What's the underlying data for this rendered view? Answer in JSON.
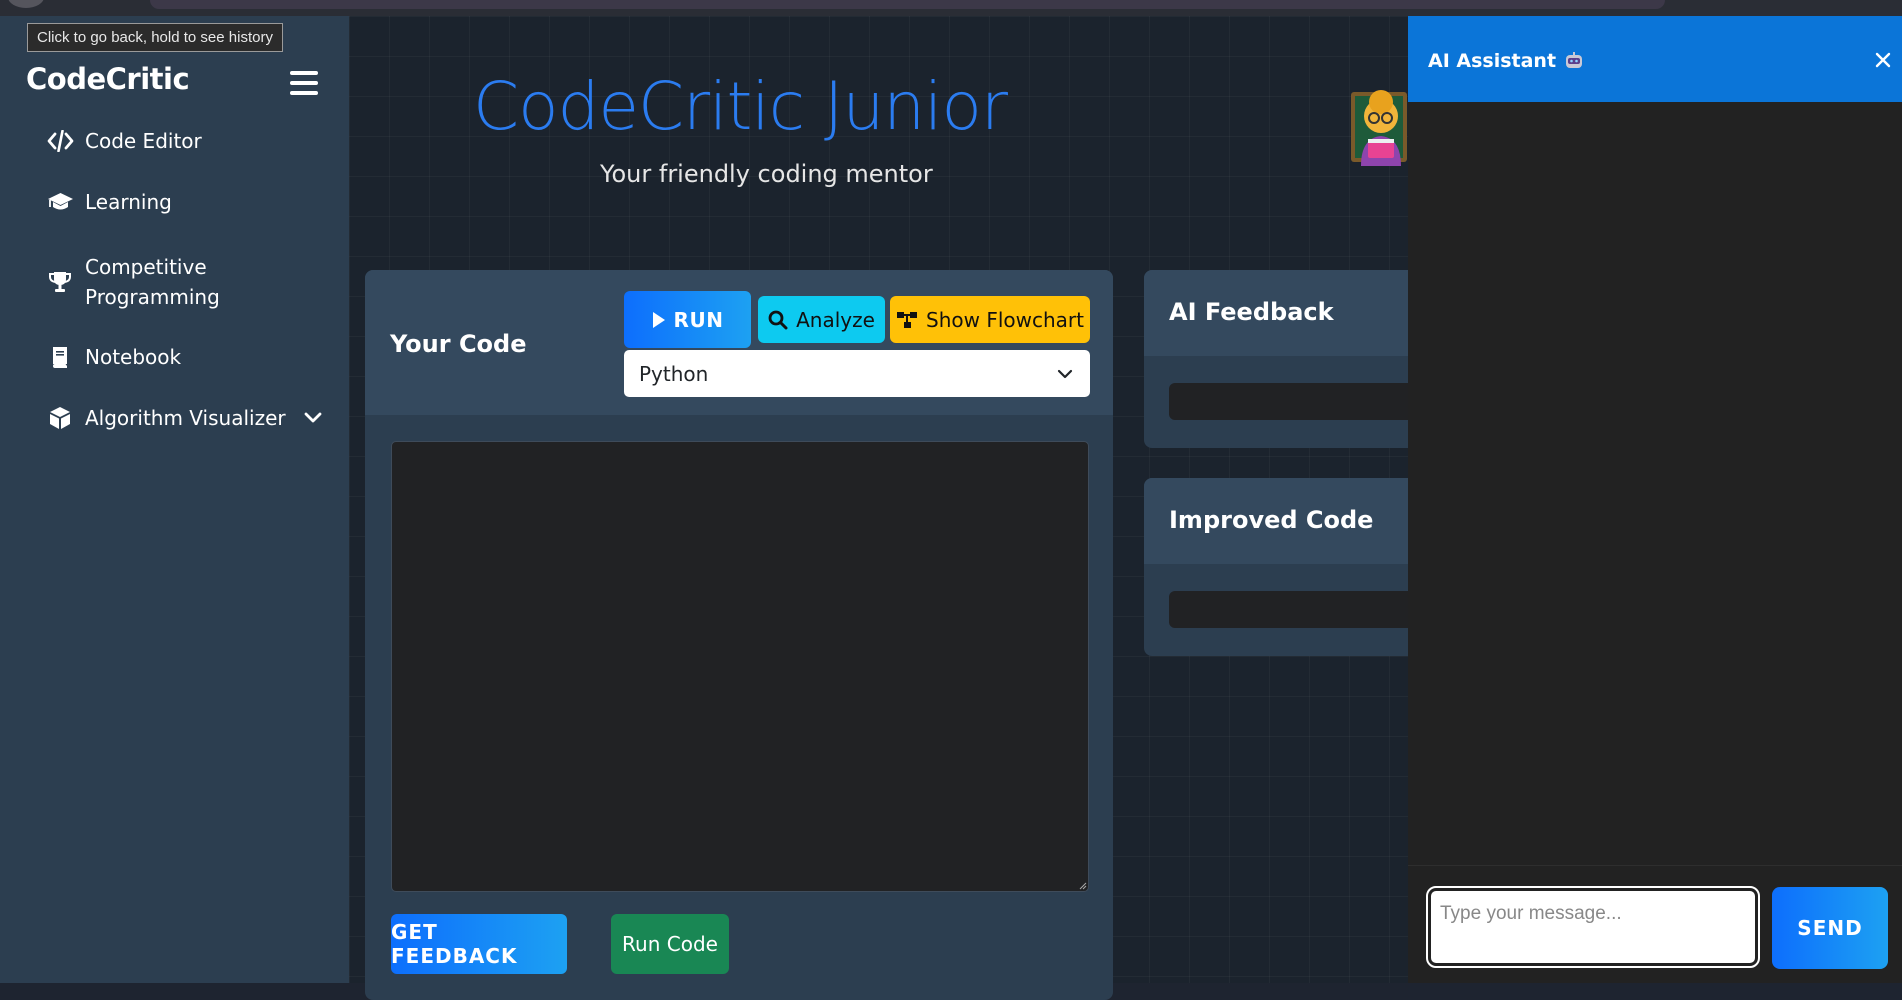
{
  "browser": {
    "back_tooltip": "Click to go back, hold to see history"
  },
  "sidebar": {
    "brand": "CodeCritic",
    "items": [
      {
        "label": "Code Editor",
        "icon": "code-icon"
      },
      {
        "label": "Learning",
        "icon": "graduation-cap-icon"
      },
      {
        "label": "Competitive Programming",
        "icon": "trophy-icon"
      },
      {
        "label": "Notebook",
        "icon": "book-icon"
      },
      {
        "label": "Algorithm Visualizer",
        "icon": "cube-icon",
        "expandable": true
      }
    ]
  },
  "header": {
    "title": "CodeCritic Junior",
    "title_emoji": "teacher-emoji",
    "subtitle": "Your friendly coding mentor"
  },
  "editor": {
    "title": "Your Code",
    "run_label": "RUN",
    "analyze_label": "Analyze",
    "flowchart_label": "Show Flowchart",
    "language_selected": "Python",
    "code": "",
    "get_feedback_label": "GET FEEDBACK",
    "run_code_label": "Run Code"
  },
  "feedback_panel": {
    "title": "AI Feedback"
  },
  "improved_panel": {
    "title": "Improved Code"
  },
  "chat": {
    "title": "AI Assistant",
    "title_icon": "robot-icon",
    "input_placeholder": "Type your message...",
    "send_label": "SEND"
  },
  "colors": {
    "accent_blue": "#0d6efd",
    "info_cyan": "#0dcaf0",
    "warning_yellow": "#ffc107",
    "success_green": "#198754",
    "sidebar_bg": "#2c3e50",
    "title_blue": "#2b7cf0"
  }
}
